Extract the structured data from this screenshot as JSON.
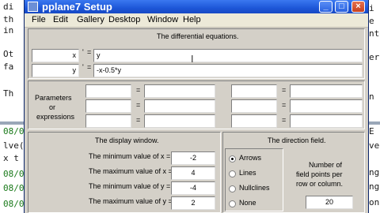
{
  "background": {
    "code_lines": [
      "di",
      "th",
      "in",
      "Ot",
      "fa",
      "Th"
    ],
    "bottom_lines": [
      "08/0",
      "lve(",
      "x t",
      "08/0",
      "08/0",
      "08/0"
    ],
    "right_fragments": [
      "i",
      "e",
      "nte",
      "er",
      "n",
      "E",
      "ve",
      "ng",
      "ng",
      "on"
    ]
  },
  "window": {
    "title": "pplane7 Setup",
    "controls": {
      "minimize": "_",
      "maximize": "□",
      "close": "×"
    }
  },
  "menu": [
    "File",
    "Edit",
    "Gallery",
    "Desktop",
    "Window",
    "Help"
  ],
  "equations": {
    "title": "The differential equations.",
    "rows": [
      {
        "var": "x",
        "prime": "'",
        "eq": "=",
        "value": "y"
      },
      {
        "var": "y",
        "prime": "'",
        "eq": "=",
        "value": "-x-0.5*y"
      }
    ]
  },
  "parameters": {
    "label_lines": [
      "Parameters",
      "or",
      "expressions"
    ],
    "eq": "="
  },
  "display": {
    "title": "The display window.",
    "rows": [
      {
        "label": "The minimum value of x =",
        "value": "-2"
      },
      {
        "label": "The maximum value of x =",
        "value": "4"
      },
      {
        "label": "The minimum value of y =",
        "value": "-4"
      },
      {
        "label": "The maximum value of y =",
        "value": "2"
      }
    ]
  },
  "direction": {
    "title": "The direction field.",
    "options": [
      "Arrows",
      "Lines",
      "Nullclines",
      "None"
    ],
    "selected": "Arrows",
    "points_label_lines": [
      "Number of",
      "field points per",
      "row or column."
    ],
    "points_value": "20"
  }
}
